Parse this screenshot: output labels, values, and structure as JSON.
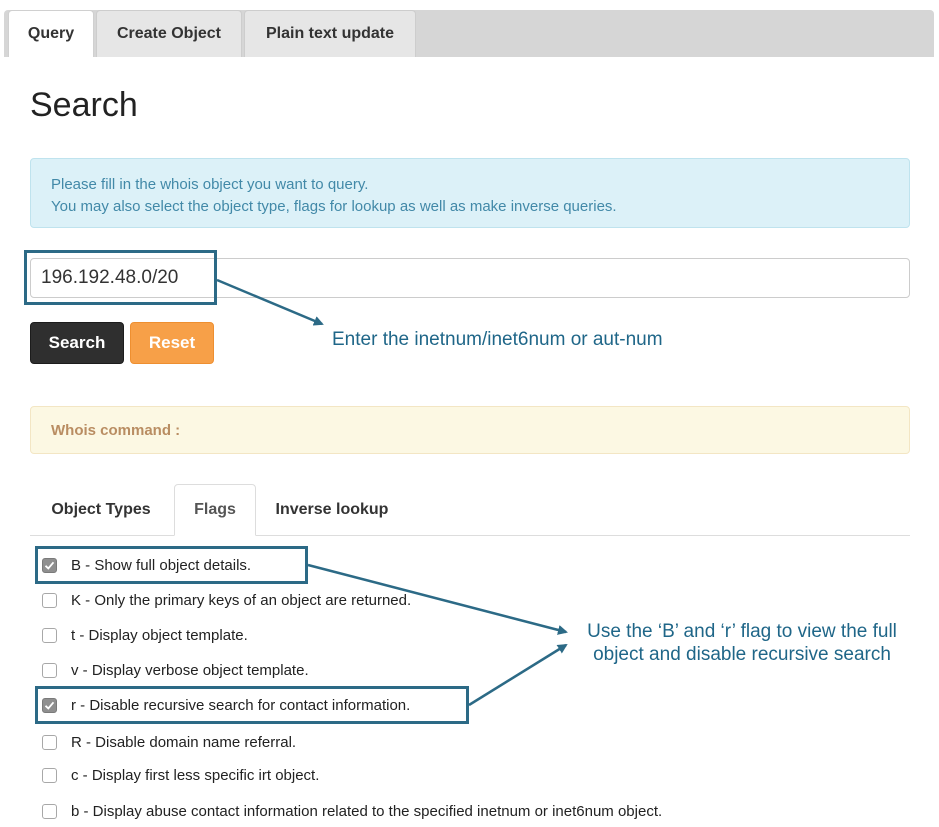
{
  "tabs": {
    "query": "Query",
    "create_object": "Create Object",
    "plain_text_update": "Plain text update"
  },
  "page_title": "Search",
  "info": {
    "line1": "Please fill in the whois object you want to query.",
    "line2": "You may also select the object type, flags for lookup as well as make inverse queries."
  },
  "query_input": {
    "value": "196.192.48.0/20"
  },
  "buttons": {
    "search": "Search",
    "reset": "Reset"
  },
  "whois_command_label": "Whois command :",
  "sub_tabs": {
    "object_types": "Object Types",
    "flags": "Flags",
    "inverse_lookup": "Inverse lookup"
  },
  "flags": [
    {
      "label": "B - Show full object details.",
      "checked": true
    },
    {
      "label": "K - Only the primary keys of an object are returned.",
      "checked": false
    },
    {
      "label": "t - Display object template.",
      "checked": false
    },
    {
      "label": "v - Display verbose object template.",
      "checked": false
    },
    {
      "label": "r - Disable recursive search for contact information.",
      "checked": true
    },
    {
      "label": "R - Disable domain name referral.",
      "checked": false
    },
    {
      "label": "c - Display first less specific irt object.",
      "checked": false
    },
    {
      "label": "b - Display abuse contact information related to the specified inetnum or inet6num object.",
      "checked": false
    }
  ],
  "annotations": {
    "input_hint": "Enter the inetnum/inet6num or aut-num",
    "flag_hint_line1": "Use the ‘B’ and ‘r’ flag to view the full",
    "flag_hint_line2": "object and disable recursive search"
  },
  "colors": {
    "annotation": "#2c6a86",
    "info_text": "#4289a8",
    "reset_button": "#f7a048",
    "search_button": "#2f2f2f"
  }
}
